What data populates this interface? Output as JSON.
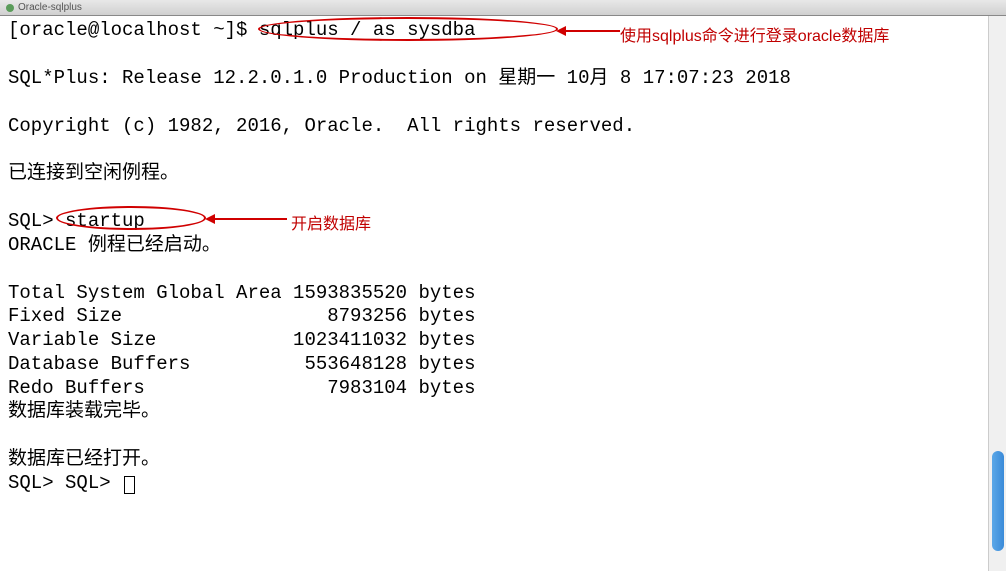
{
  "title_bar": {
    "text": "Oracle-sqlplus"
  },
  "terminal": {
    "line1_prompt": "[oracle@localhost ~]$ ",
    "line1_cmd": "sqlplus / as sysdba",
    "line2": "",
    "line3": "SQL*Plus: Release 12.2.0.1.0 Production on 星期一 10月 8 17:07:23 2018",
    "line4": "",
    "line5": "Copyright (c) 1982, 2016, Oracle.  All rights reserved.",
    "line6": "",
    "line7": "已连接到空闲例程。",
    "line8": "",
    "line9_prompt": "SQL> ",
    "line9_cmd": "startup",
    "line10": "ORACLE 例程已经启动。",
    "line11": "",
    "line12": "Total System Global Area 1593835520 bytes",
    "line13": "Fixed Size                  8793256 bytes",
    "line14": "Variable Size            1023411032 bytes",
    "line15": "Database Buffers          553648128 bytes",
    "line16": "Redo Buffers                7983104 bytes",
    "line17": "数据库装载完毕。",
    "line18": "",
    "line19": "数据库已经打开。",
    "line20_prompt": "SQL> SQL> "
  },
  "annotations": {
    "note1": "使用sqlplus命令进行登录oracle数据库",
    "note2": "开启数据库"
  }
}
